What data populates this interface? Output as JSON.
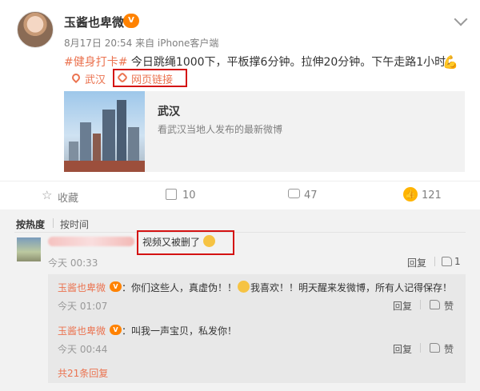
{
  "post": {
    "author": "玉酱也卑微",
    "vip_badge": "V",
    "meta": "8月17日 20:54 来自 iPhone客户端",
    "hashtag": "#健身打卡#",
    "text": " 今日跳绳1000下，平板撑6分钟。拉伸20分钟。下午走路1小时。",
    "emoji": "💪",
    "location": "武汉",
    "web_link": "网页链接"
  },
  "card": {
    "title": "武汉",
    "desc": "看武汉当地人发布的最新微博"
  },
  "actions": {
    "favorite": "收藏",
    "forward": "10",
    "comment": "47",
    "like": "121"
  },
  "comments": {
    "sort_hot": "按热度",
    "sort_time": "按时间",
    "main": {
      "text": "视频又被删了",
      "time": "今天 00:33",
      "reply": "回复"
    },
    "replies": [
      {
        "author": "玉酱也卑微",
        "text_a": "：你们这些人，真虚伪！！",
        "text_b": "我喜欢！！明天醒来发微博，所有人记得保存！",
        "time": "今天 01:07",
        "reply": "回复",
        "like": "赞"
      },
      {
        "author": "玉酱也卑微",
        "text_a": "：叫我一声宝贝，私发你！",
        "time": "今天 00:44",
        "reply": "回复",
        "like": "赞"
      }
    ],
    "more": "共21条回复"
  }
}
